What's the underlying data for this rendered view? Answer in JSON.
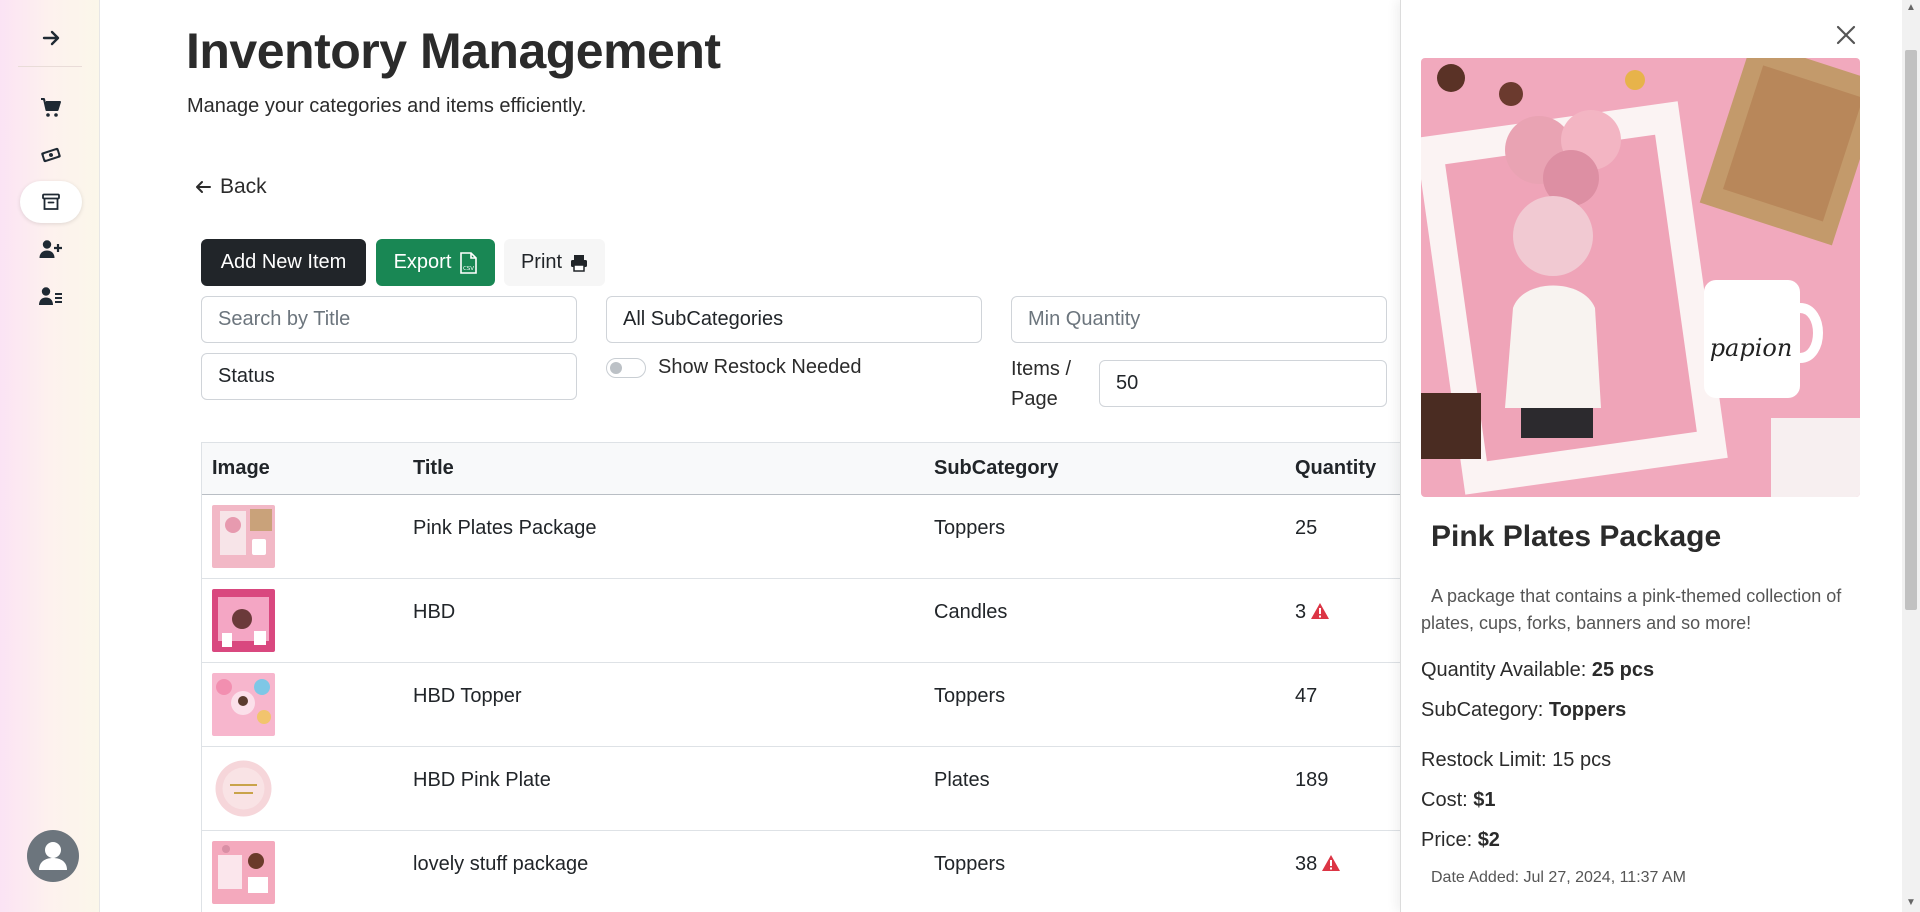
{
  "sidebar": {
    "items": [
      {
        "icon": "arrow-right-icon"
      },
      {
        "icon": "cart-icon"
      },
      {
        "icon": "money-icon"
      },
      {
        "icon": "archive-icon"
      },
      {
        "icon": "user-plus-icon"
      },
      {
        "icon": "user-list-icon"
      }
    ],
    "avatar_icon": "user-avatar-icon"
  },
  "header": {
    "title": "Inventory Management",
    "subtitle": "Manage your categories and items efficiently."
  },
  "back_label": "Back",
  "toolbar": {
    "add_label": "Add New Item",
    "export_label": "Export",
    "print_label": "Print"
  },
  "filters": {
    "search_placeholder": "Search by Title",
    "subcategory_value": "All SubCategories",
    "min_quantity_placeholder": "Min Quantity",
    "status_value": "Status",
    "restock_label": "Show Restock Needed",
    "items_per_page_label": "Items / Page",
    "items_per_page_value": "50"
  },
  "table": {
    "headers": [
      "Image",
      "Title",
      "SubCategory",
      "Quantity"
    ],
    "rows": [
      {
        "title": "Pink Plates Package",
        "subcategory": "Toppers",
        "quantity": "25",
        "warning": false
      },
      {
        "title": "HBD",
        "subcategory": "Candles",
        "quantity": "3",
        "warning": true
      },
      {
        "title": "HBD Topper",
        "subcategory": "Toppers",
        "quantity": "47",
        "warning": false
      },
      {
        "title": "HBD Pink Plate",
        "subcategory": "Plates",
        "quantity": "189",
        "warning": false
      },
      {
        "title": "lovely stuff package",
        "subcategory": "Toppers",
        "quantity": "38",
        "warning": true
      }
    ]
  },
  "detail": {
    "title": "Pink Plates Package",
    "description": "A package that contains a pink-themed collection of plates, cups, forks, banners and so more!",
    "quantity_label": "Quantity Available:",
    "quantity_value": "25 pcs",
    "subcategory_label": "SubCategory:",
    "subcategory_value": "Toppers",
    "restock_label": "Restock Limit: 15 pcs",
    "cost_label": "Cost:",
    "cost_value": "$1",
    "price_label": "Price:",
    "price_value": "$2",
    "date_added": "Date Added: Jul 27, 2024, 11:37 AM"
  },
  "colors": {
    "dark_button": "#212529",
    "export_green": "#198754",
    "warning_red": "#dc3545"
  }
}
